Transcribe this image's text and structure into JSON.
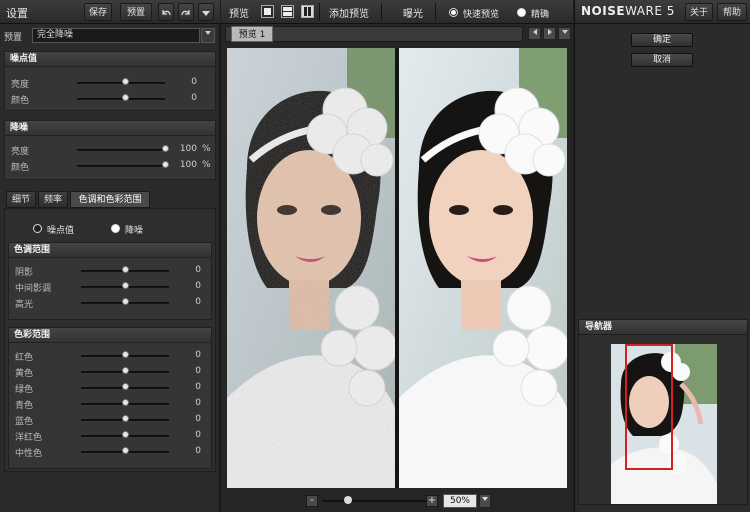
{
  "left": {
    "title": "设置",
    "save_label": "保存",
    "preset_label": "预置",
    "toolbar_icons": [
      "undo-icon",
      "redo-icon",
      "menu-arrow-icon"
    ],
    "preset_row_label": "预置",
    "preset_value": "完全降噪",
    "noise_level": {
      "header": "噪点值",
      "rows": [
        {
          "label": "亮度",
          "value": "0",
          "knob": 0.55
        },
        {
          "label": "颜色",
          "value": "0",
          "knob": 0.55
        }
      ]
    },
    "denoise": {
      "header": "降噪",
      "rows": [
        {
          "label": "亮度",
          "value": "100",
          "unit": "%",
          "knob": 1.0
        },
        {
          "label": "颜色",
          "value": "100",
          "unit": "%",
          "knob": 1.0
        }
      ]
    },
    "tabs": [
      "细节",
      "频率",
      "色调和色彩范围"
    ],
    "active_tab": 2,
    "radios": [
      {
        "label": "噪点值",
        "selected": false
      },
      {
        "label": "降噪",
        "selected": true
      }
    ],
    "tone_range": {
      "header": "色调范围",
      "rows": [
        {
          "label": "阴影",
          "value": "0",
          "knob": 0.5
        },
        {
          "label": "中间影调",
          "value": "0",
          "knob": 0.5
        },
        {
          "label": "高光",
          "value": "0",
          "knob": 0.5
        }
      ]
    },
    "color_range": {
      "header": "色彩范围",
      "rows": [
        {
          "label": "红色",
          "value": "0",
          "knob": 0.5
        },
        {
          "label": "黄色",
          "value": "0",
          "knob": 0.5
        },
        {
          "label": "绿色",
          "value": "0",
          "knob": 0.5
        },
        {
          "label": "青色",
          "value": "0",
          "knob": 0.5
        },
        {
          "label": "蓝色",
          "value": "0",
          "knob": 0.5
        },
        {
          "label": "洋红色",
          "value": "0",
          "knob": 0.5
        },
        {
          "label": "中性色",
          "value": "0",
          "knob": 0.5
        }
      ]
    }
  },
  "center": {
    "preview_label": "预览",
    "add_preview_label": "添加预览",
    "exposure_label": "曝光",
    "fast_preview_label": "快速预览",
    "accurate_label": "精确",
    "preview_tab": "预览 1",
    "zoom_minus": "-",
    "zoom_plus": "+",
    "zoom_value": "50%",
    "zoom_level": 0.25
  },
  "right": {
    "brand_bold": "NOISE",
    "brand_rest": "WARE 5",
    "about_label": "关于",
    "help_label": "帮助",
    "ok_label": "确定",
    "cancel_label": "取消",
    "navigator_header": "导航器"
  },
  "colors": {
    "panel_bg": "#2b2b2b",
    "group_bg": "#353535",
    "navigator_frame": "#d42020"
  }
}
